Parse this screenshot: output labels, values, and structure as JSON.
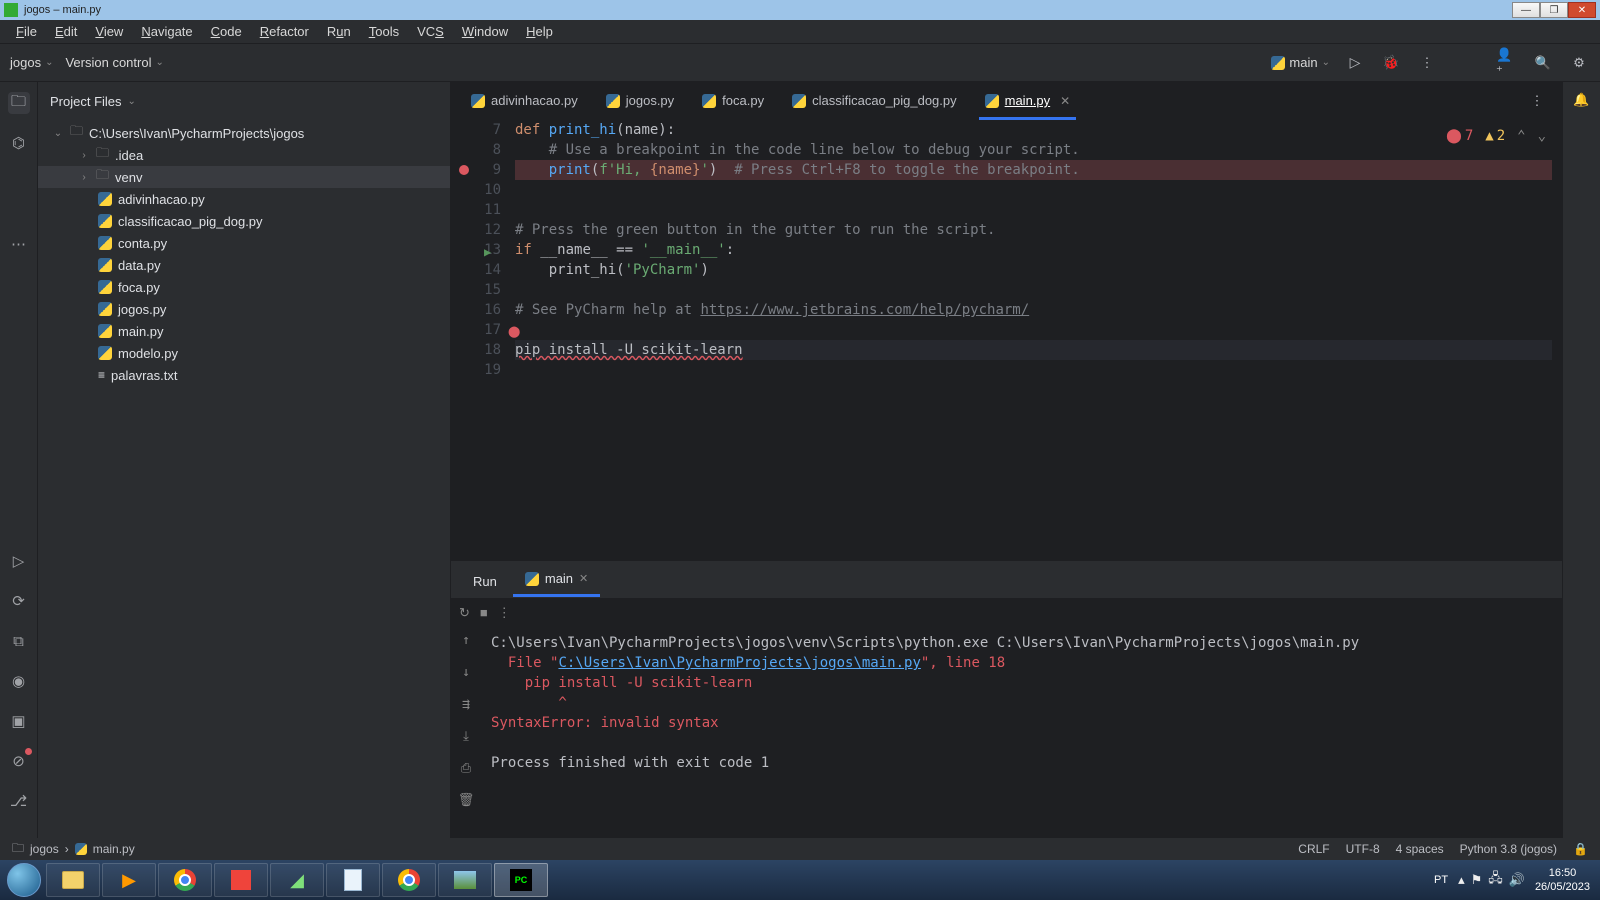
{
  "titlebar": {
    "text": "jogos – main.py"
  },
  "menubar": [
    "File",
    "Edit",
    "View",
    "Navigate",
    "Code",
    "Refactor",
    "Run",
    "Tools",
    "VCS",
    "Window",
    "Help"
  ],
  "toolbar": {
    "project": "jogos",
    "vcs": "Version control",
    "runconfig": "main"
  },
  "project_panel": {
    "title": "Project Files",
    "root": "C:\\Users\\Ivan\\PycharmProjects\\jogos",
    "folders": [
      ".idea",
      "venv"
    ],
    "files": [
      "adivinhacao.py",
      "classificacao_pig_dog.py",
      "conta.py",
      "data.py",
      "foca.py",
      "jogos.py",
      "main.py",
      "modelo.py",
      "palavras.txt"
    ]
  },
  "tabs": [
    {
      "label": "adivinhacao.py"
    },
    {
      "label": "jogos.py"
    },
    {
      "label": "foca.py"
    },
    {
      "label": "classificacao_pig_dog.py"
    },
    {
      "label": "main.py",
      "active": true
    }
  ],
  "inspection": {
    "errors": "7",
    "warnings": "2"
  },
  "code": {
    "l7": {
      "pre": "def ",
      "fn": "print_hi",
      "post": "(name):"
    },
    "l8": "    # Use a breakpoint in the code line below to debug your script.",
    "l9": {
      "a": "    ",
      "b": "print",
      "c": "(",
      "d": "f'Hi, ",
      "e": "{name}",
      "f": "'",
      "g": ")  ",
      "h": "# Press Ctrl+F8 to toggle the breakpoint."
    },
    "l12": "# Press the green button in the gutter to run the script.",
    "l13": {
      "a": "if ",
      "b": "__name__ ",
      "c": "== ",
      "d": "'__main__'",
      "e": ":"
    },
    "l14": {
      "a": "    print_hi(",
      "b": "'PyCharm'",
      "c": ")"
    },
    "l16": {
      "a": "# See PyCharm help at ",
      "b": "https://www.jetbrains.com/help/pycharm/"
    },
    "l18": "pip install -U scikit-learn"
  },
  "run": {
    "tab_label": "Run",
    "config": "main",
    "out1": "C:\\Users\\Ivan\\PycharmProjects\\jogos\\venv\\Scripts\\python.exe C:\\Users\\Ivan\\PycharmProjects\\jogos\\main.py",
    "out2a": "  File \"",
    "out2b": "C:\\Users\\Ivan\\PycharmProjects\\jogos\\main.py",
    "out2c": "\", line 18",
    "out3": "    pip install -U scikit-learn",
    "out4": "        ^",
    "out5": "SyntaxError: invalid syntax",
    "out6": "Process finished with exit code 1"
  },
  "breadcrumb": {
    "a": "jogos",
    "b": "main.py"
  },
  "statusbar": {
    "eol": "CRLF",
    "enc": "UTF-8",
    "indent": "4 spaces",
    "interp": "Python 3.8 (jogos)"
  },
  "taskbar": {
    "lang": "PT",
    "time": "16:50",
    "date": "26/05/2023"
  }
}
